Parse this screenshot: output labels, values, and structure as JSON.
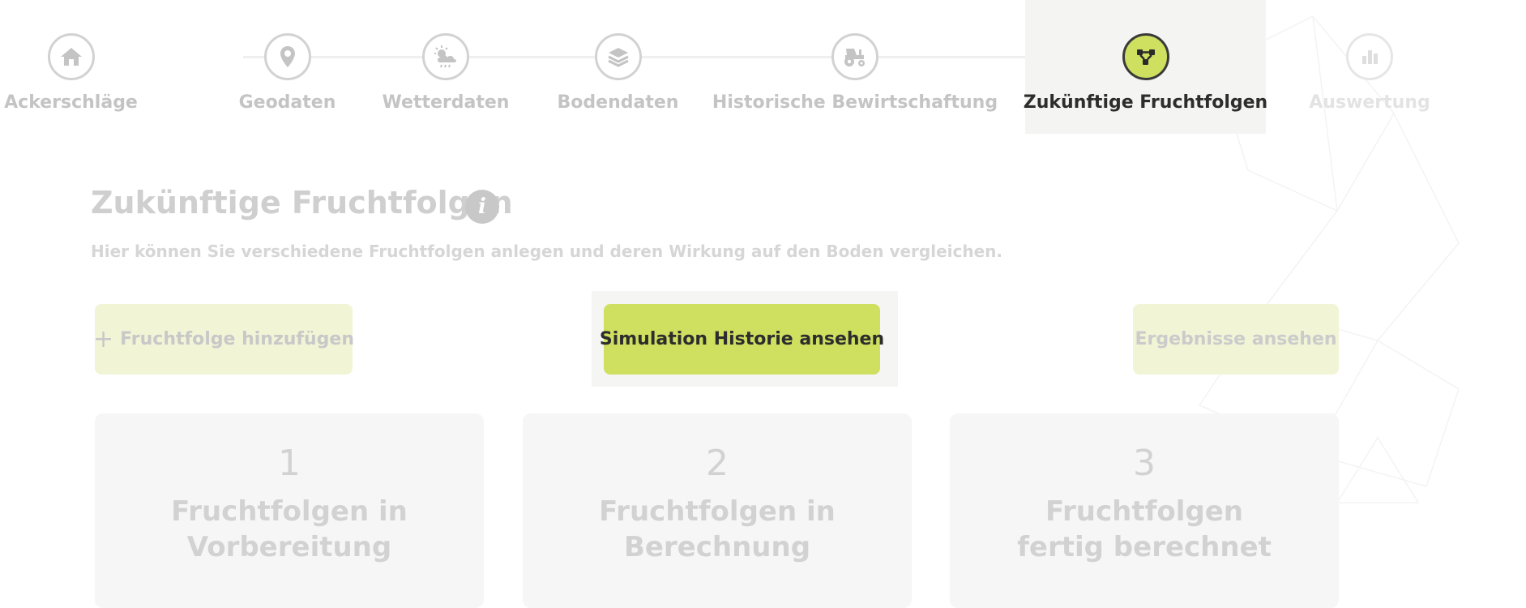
{
  "stepper": {
    "steps": [
      {
        "label": "Ackerschläge",
        "icon": "home-icon",
        "state": "done"
      },
      {
        "label": "Geodaten",
        "icon": "map-pin-icon",
        "state": "done"
      },
      {
        "label": "Wetterdaten",
        "icon": "weather-icon",
        "state": "done"
      },
      {
        "label": "Bodendaten",
        "icon": "layers-icon",
        "state": "done"
      },
      {
        "label": "Historische Bewirtschaftung",
        "icon": "tractor-icon",
        "state": "done"
      },
      {
        "label": "Zukünftige Fruchtfolgen",
        "icon": "flow-nodes-icon",
        "state": "active"
      },
      {
        "label": "Auswertung",
        "icon": "bar-chart-icon",
        "state": "disabled"
      }
    ]
  },
  "main": {
    "title": "Zukünftige Fruchtfolgen",
    "info_icon": "i",
    "subtitle": "Hier können Sie verschiedene Fruchtfolgen anlegen und deren Wirkung auf den Boden vergleichen."
  },
  "actions": {
    "add_icon": "+",
    "add_label": "Fruchtfolge hinzufügen",
    "simulation_label": "Simulation Historie ansehen",
    "results_label": "Ergebnisse ansehen"
  },
  "cards": [
    {
      "number": "1",
      "label": "Fruchtfolgen in Vorbereitung"
    },
    {
      "number": "2",
      "label": "Fruchtfolgen in Berechnung"
    },
    {
      "number": "3",
      "label": "Fruchtfolgen fertig berechnet"
    }
  ],
  "colors": {
    "accent": "#cfdf5f",
    "accent_light": "#f1f5d6",
    "muted_text": "#c4c4c4",
    "dark_text": "#2d2d2d"
  }
}
